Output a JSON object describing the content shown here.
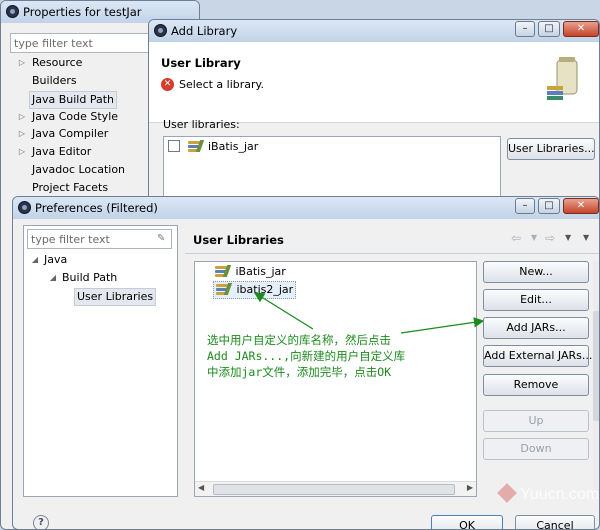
{
  "properties_window": {
    "title": "Properties for testJar",
    "filter_placeholder": "type filter text",
    "nav": [
      {
        "label": "Resource",
        "expandable": true
      },
      {
        "label": "Builders",
        "expandable": false
      },
      {
        "label": "Java Build Path",
        "expandable": false,
        "selected": true
      },
      {
        "label": "Java Code Style",
        "expandable": true
      },
      {
        "label": "Java Compiler",
        "expandable": true
      },
      {
        "label": "Java Editor",
        "expandable": true
      },
      {
        "label": "Javadoc Location",
        "expandable": false
      },
      {
        "label": "Project Facets",
        "expandable": false
      }
    ]
  },
  "add_library_dialog": {
    "title": "Add Library",
    "header": "User Library",
    "message": "Select a library.",
    "list_label": "User libraries:",
    "libraries": [
      {
        "label": "iBatis_jar",
        "checked": false
      }
    ],
    "user_libraries_button": "User Libraries..."
  },
  "preferences_dialog": {
    "title": "Preferences (Filtered)",
    "filter_placeholder": "type filter text",
    "tree": [
      {
        "label": "Java"
      },
      {
        "label": "Build Path"
      },
      {
        "label": "User Libraries",
        "selected": true
      }
    ],
    "page_title": "User Libraries",
    "libraries": [
      "iBatis_jar",
      "ibatis2_jar"
    ],
    "annotation_lines": [
      "选中用户自定义的库名称，然后点击",
      "Add JARs...,向新建的用户自定义库",
      "中添加jar文件，添加完毕，点击OK"
    ],
    "buttons": {
      "new": "New...",
      "edit": "Edit...",
      "add_jars": "Add JARs...",
      "add_external_jars": "Add External JARs...",
      "remove": "Remove",
      "up": "Up",
      "down": "Down"
    },
    "footer": {
      "ok": "OK",
      "cancel": "Cancel"
    }
  },
  "watermark": "Yuucn.com",
  "colors": {
    "title_bar": "#c2d3e8",
    "close_button": "#c4432b",
    "annotation": "#1d8a1d",
    "error_icon": "#d43c2c"
  }
}
